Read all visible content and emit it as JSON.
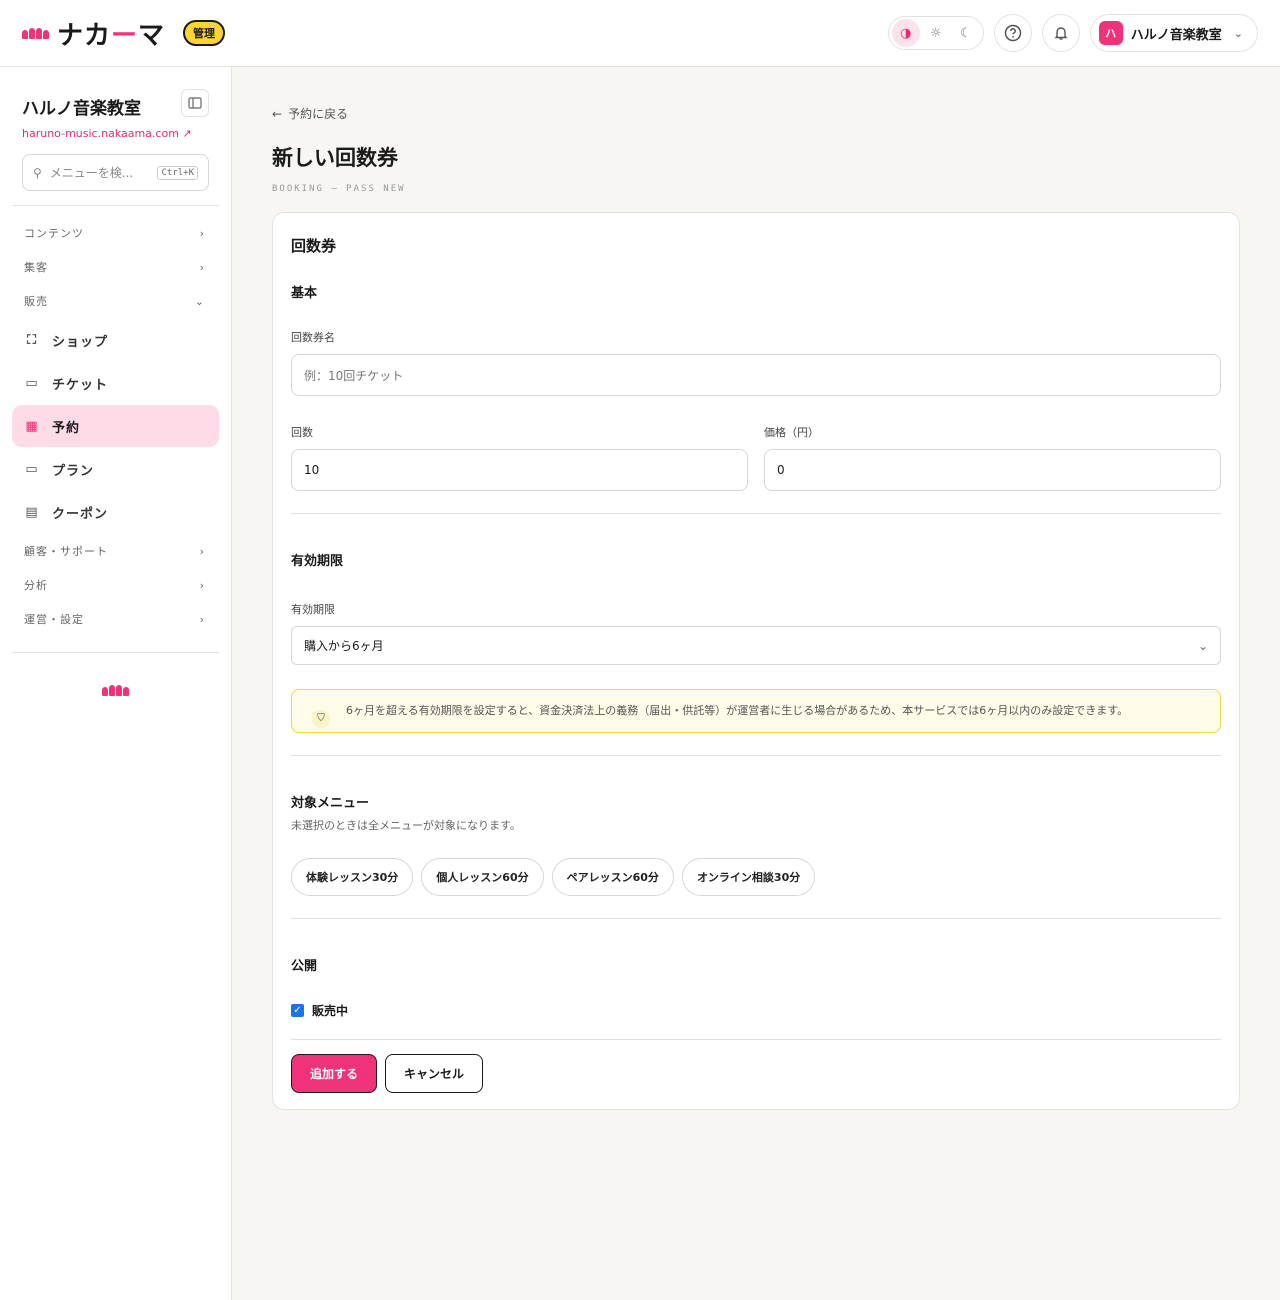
{
  "header": {
    "logo_text_a": "ナカ",
    "logo_text_dash": "ー",
    "logo_text_b": "マ",
    "badge": "管理",
    "org_name": "ハルノ音楽教室",
    "org_initial": "ハ"
  },
  "sidebar": {
    "title": "ハルノ音楽教室",
    "url": "haruno-music.nakaama.com",
    "search_placeholder": "メニューを検...",
    "search_shortcut": "Ctrl+K",
    "groups_top": [
      {
        "label": "コンテンツ",
        "chevron": "›"
      },
      {
        "label": "集客",
        "chevron": "›"
      },
      {
        "label": "販売",
        "chevron": "⌄"
      }
    ],
    "items": [
      {
        "label": "ショップ",
        "icon": "bag-icon"
      },
      {
        "label": "チケット",
        "icon": "ticket-icon"
      },
      {
        "label": "予約",
        "icon": "calendar-icon",
        "active": true
      },
      {
        "label": "プラン",
        "icon": "card-icon"
      },
      {
        "label": "クーポン",
        "icon": "coupon-icon"
      }
    ],
    "groups_bottom": [
      {
        "label": "顧客・サポート",
        "chevron": "›"
      },
      {
        "label": "分析",
        "chevron": "›"
      },
      {
        "label": "運営・設定",
        "chevron": "›"
      }
    ]
  },
  "main": {
    "back_label": "予約に戻る",
    "title": "新しい回数券",
    "subtitle": "BOOKING — PASS NEW",
    "card_title": "回数券",
    "basic": {
      "section": "基本",
      "name_label": "回数券名",
      "name_placeholder": "例：10回チケット",
      "count_label": "回数",
      "count_value": "10",
      "price_label": "価格（円）",
      "price_value": "0"
    },
    "validity": {
      "section": "有効期限",
      "label": "有効期限",
      "selected": "購入から6ヶ月",
      "notice": "6ヶ月を超える有効期限を設定すると、資金決済法上の義務（届出・供託等）が運営者に生じる場合があるため、本サービスでは6ヶ月以内のみ設定できます。"
    },
    "menus": {
      "section": "対象メニュー",
      "hint": "未選択のときは全メニューが対象になります。",
      "chips": [
        "体験レッスン30分",
        "個人レッスン60分",
        "ペアレッスン60分",
        "オンライン相談30分"
      ]
    },
    "publish": {
      "section": "公開",
      "checkbox_label": "販売中",
      "checked": true
    },
    "actions": {
      "submit": "追加する",
      "cancel": "キャンセル"
    }
  },
  "colors": {
    "brand": "#f0327a",
    "active_bg": "#fddbe7",
    "badge": "#fcd535",
    "notice_bg": "#fefbe8"
  }
}
